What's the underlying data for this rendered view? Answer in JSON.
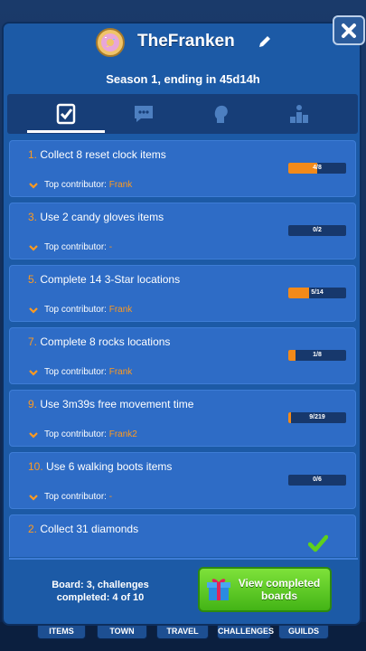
{
  "header": {
    "title": "TheFranken",
    "season": "Season 1, ending in 45d14h"
  },
  "tabs": [
    {
      "icon": "checklist-icon"
    },
    {
      "icon": "chat-icon"
    },
    {
      "icon": "profile-head-icon"
    },
    {
      "icon": "leaderboard-icon"
    }
  ],
  "challenges": [
    {
      "num": "1.",
      "text": "Collect 8 reset clock items",
      "contrib_label": "Top contributor:",
      "contributor": "Frank",
      "progress_text": "4/8",
      "progress": 0.5
    },
    {
      "num": "3.",
      "text": "Use 2 candy gloves items",
      "contrib_label": "Top contributor:",
      "contributor": "-",
      "progress_text": "0/2",
      "progress": 0
    },
    {
      "num": "5.",
      "text": "Complete 14 3-Star locations",
      "contrib_label": "Top contributor:",
      "contributor": "Frank",
      "progress_text": "5/14",
      "progress": 0.357
    },
    {
      "num": "7.",
      "text": "Complete 8 rocks locations",
      "contrib_label": "Top contributor:",
      "contributor": "Frank",
      "progress_text": "1/8",
      "progress": 0.125
    },
    {
      "num": "9.",
      "text": "Use 3m39s free movement time",
      "contrib_label": "Top contributor:",
      "contributor": "Frank2",
      "progress_text": "9/219",
      "progress": 0.041
    },
    {
      "num": "10.",
      "text": "Use 6 walking boots items",
      "contrib_label": "Top contributor:",
      "contributor": "-",
      "progress_text": "0/6",
      "progress": 0
    },
    {
      "num": "2.",
      "text": "Collect 31 diamonds",
      "completed": true
    }
  ],
  "footer": {
    "board_line1": "Board: 3, challenges",
    "board_line2": "completed: 4 of 10",
    "view_line1": "View completed",
    "view_line2": "boards"
  },
  "bottom_nav": [
    "ITEMS",
    "TOWN",
    "TRAVEL",
    "CHALLENGES",
    "GUILDS"
  ],
  "colors": {
    "accent_orange": "#ff9a1f",
    "progress_fill": "#f28a1a",
    "button_green": "#43b416"
  }
}
